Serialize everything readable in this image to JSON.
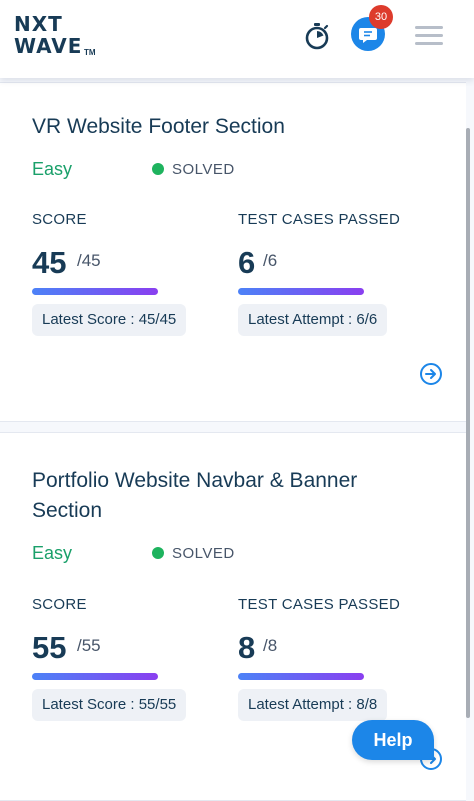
{
  "header": {
    "logo_line1": "NXT",
    "logo_line2": "WAVE",
    "logo_tm": "TM",
    "chat_badge": "30"
  },
  "problems": [
    {
      "title": "VR Website Footer Section",
      "difficulty": "Easy",
      "status": "SOLVED",
      "score_label": "SCORE",
      "score": "45",
      "score_total": "/45",
      "tests_label": "TEST CASES PASSED",
      "tests": "6",
      "tests_total": "/6",
      "score_progress": 1.0,
      "tests_progress": 1.0,
      "latest_score": "Latest Score : 45/45",
      "latest_attempt": "Latest Attempt : 6/6"
    },
    {
      "title": "Portfolio Website Navbar & Banner Section",
      "difficulty": "Easy",
      "status": "SOLVED",
      "score_label": "SCORE",
      "score": "55",
      "score_total": "/55",
      "tests_label": "TEST CASES PASSED",
      "tests": "8",
      "tests_total": "/8",
      "score_progress": 1.0,
      "tests_progress": 1.0,
      "latest_score": "Latest Score : 55/55",
      "latest_attempt": "Latest Attempt : 8/8"
    }
  ],
  "help": {
    "label": "Help"
  },
  "colors": {
    "primary": "#1c86e8",
    "badge": "#dd3b2c",
    "easy": "#1aa06a",
    "solved_dot": "#1eb35e",
    "title": "#183b56"
  }
}
